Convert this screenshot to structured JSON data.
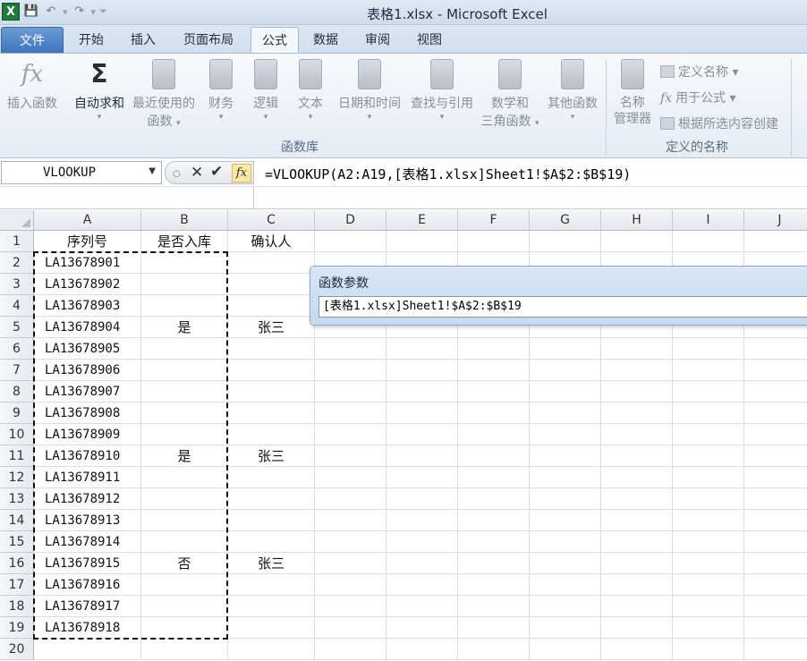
{
  "window": {
    "title": "表格1.xlsx - Microsoft Excel",
    "app_icon_label": "X"
  },
  "quick_access": {
    "save_icon": "save-icon",
    "undo_icon": "undo-icon",
    "redo_icon": "redo-icon"
  },
  "tabs": [
    {
      "label": "文件"
    },
    {
      "label": "开始"
    },
    {
      "label": "插入"
    },
    {
      "label": "页面布局"
    },
    {
      "label": "公式"
    },
    {
      "label": "数据"
    },
    {
      "label": "审阅"
    },
    {
      "label": "视图"
    }
  ],
  "ribbon": {
    "function_library": {
      "group_label": "函数库",
      "insert_function": "插入函数",
      "autosum": "自动求和",
      "recent_line1": "最近使用的",
      "recent_line2": "函数",
      "financial": "财务",
      "logical": "逻辑",
      "text": "文本",
      "datetime": "日期和时间",
      "lookup": "查找与引用",
      "math_line1": "数学和",
      "math_line2": "三角函数",
      "other": "其他函数"
    },
    "defined_names": {
      "group_label": "定义的名称",
      "name_manager_line1": "名称",
      "name_manager_line2": "管理器",
      "define_name": "定义名称",
      "use_in_formula": "用于公式",
      "create_from_selection": "根据所选内容创建"
    }
  },
  "formula_bar": {
    "name_box": "VLOOKUP",
    "formula": "=VLOOKUP(A2:A19,[表格1.xlsx]Sheet1!$A$2:$B$19)"
  },
  "sheet": {
    "columns": [
      "A",
      "B",
      "C",
      "D",
      "E",
      "F",
      "G",
      "H",
      "I",
      "J"
    ],
    "rows": [
      {
        "n": "1",
        "a": "序列号",
        "b": "是否入库",
        "c": "确认人"
      },
      {
        "n": "2",
        "a": "LA13678901",
        "b": "",
        "c": ""
      },
      {
        "n": "3",
        "a": "LA13678902",
        "b": "",
        "c": ""
      },
      {
        "n": "4",
        "a": "LA13678903",
        "b": "",
        "c": ""
      },
      {
        "n": "5",
        "a": "LA13678904",
        "b": "是",
        "c": "张三"
      },
      {
        "n": "6",
        "a": "LA13678905",
        "b": "",
        "c": ""
      },
      {
        "n": "7",
        "a": "LA13678906",
        "b": "",
        "c": ""
      },
      {
        "n": "8",
        "a": "LA13678907",
        "b": "",
        "c": ""
      },
      {
        "n": "9",
        "a": "LA13678908",
        "b": "",
        "c": ""
      },
      {
        "n": "10",
        "a": "LA13678909",
        "b": "",
        "c": ""
      },
      {
        "n": "11",
        "a": "LA13678910",
        "b": "是",
        "c": "张三"
      },
      {
        "n": "12",
        "a": "LA13678911",
        "b": "",
        "c": ""
      },
      {
        "n": "13",
        "a": "LA13678912",
        "b": "",
        "c": ""
      },
      {
        "n": "14",
        "a": "LA13678913",
        "b": "",
        "c": ""
      },
      {
        "n": "15",
        "a": "LA13678914",
        "b": "",
        "c": ""
      },
      {
        "n": "16",
        "a": "LA13678915",
        "b": "否",
        "c": "张三"
      },
      {
        "n": "17",
        "a": "LA13678916",
        "b": "",
        "c": ""
      },
      {
        "n": "18",
        "a": "LA13678917",
        "b": "",
        "c": ""
      },
      {
        "n": "19",
        "a": "LA13678918",
        "b": "",
        "c": ""
      },
      {
        "n": "20",
        "a": "",
        "b": "",
        "c": ""
      }
    ]
  },
  "dialog": {
    "title": "函数参数",
    "input_value": "[表格1.xlsx]Sheet1!$A$2:$B$19"
  }
}
